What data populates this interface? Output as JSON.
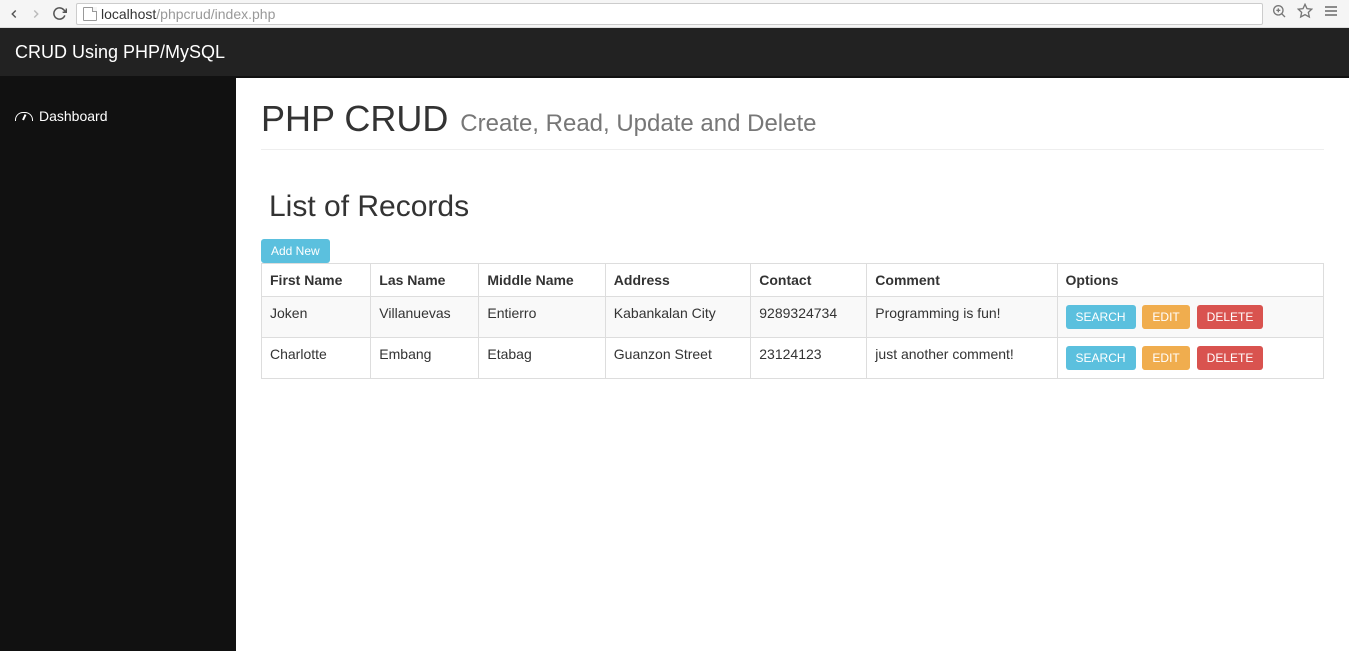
{
  "browser": {
    "url_host": "localhost",
    "url_path": "/phpcrud/index.php"
  },
  "navbar": {
    "brand": "CRUD Using PHP/MySQL"
  },
  "sidebar": {
    "items": [
      {
        "label": "Dashboard"
      }
    ]
  },
  "main": {
    "title": "PHP CRUD",
    "title_small": "Create, Read, Update and Delete",
    "subtitle": "List of Records",
    "add_new_label": "Add New",
    "table": {
      "headers": [
        "First Name",
        "Las Name",
        "Middle Name",
        "Address",
        "Contact",
        "Comment",
        "Options"
      ],
      "rows": [
        {
          "first_name": "Joken",
          "last_name": "Villanuevas",
          "middle_name": "Entierro",
          "address": "Kabankalan City",
          "contact": "9289324734",
          "comment": "Programming is fun!"
        },
        {
          "first_name": "Charlotte",
          "last_name": "Embang",
          "middle_name": "Etabag",
          "address": "Guanzon Street",
          "contact": "23124123",
          "comment": "just another comment!"
        }
      ],
      "actions": {
        "search": "SEARCH",
        "edit": "EDIT",
        "delete": "DELETE"
      }
    }
  }
}
